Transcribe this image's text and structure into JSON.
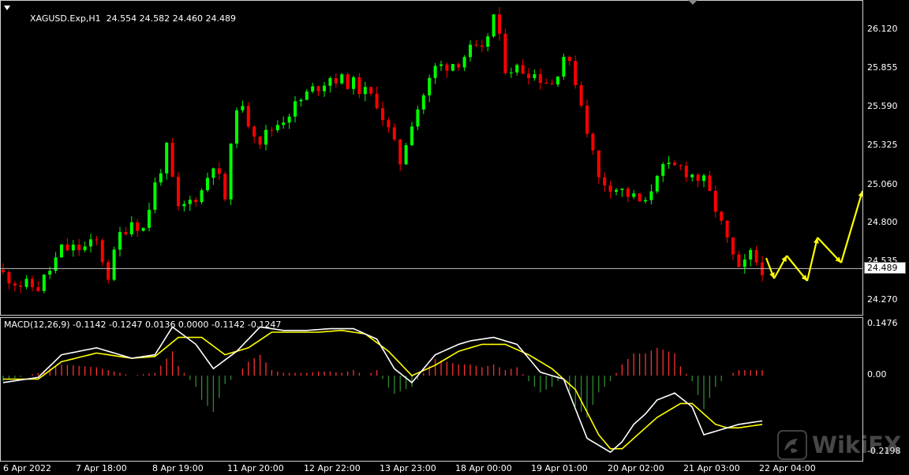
{
  "chart_header": {
    "symbol_menu_icon": "triangle-down-icon",
    "symbol_timeframe": "XAGUSD.Exp,H1",
    "ohlc": "24.554 24.582 24.460 24.489"
  },
  "macd_header": {
    "text": "MACD(12,26,9) -0.1142 -0.1247 0.0136 0.0000 -0.1142 -0.1247"
  },
  "price_axis": [
    "26.120",
    "25.855",
    "25.590",
    "25.325",
    "25.060",
    "24.800",
    "24.535",
    "24.270"
  ],
  "current_price": "24.489",
  "macd_axis": [
    "0.1476",
    "0.00",
    "-0.2198"
  ],
  "time_axis": [
    "6 Apr 2022",
    "7 Apr 18:00",
    "8 Apr 19:00",
    "11 Apr 20:00",
    "12 Apr 22:00",
    "13 Apr 23:00",
    "18 Apr 00:00",
    "19 Apr 01:00",
    "20 Apr 02:00",
    "21 Apr 03:00",
    "22 Apr 04:00"
  ],
  "watermark": {
    "text": "WikiFX",
    "icon": "wikifx-logo-icon"
  },
  "colors": {
    "background": "#000000",
    "bull_candle": "#00ff00",
    "bear_candle": "#ff0000",
    "macd_line": "#ffffff",
    "signal_line": "#ffff00",
    "histogram_positive": "#ff3030",
    "histogram_negative": "#2e8b2e",
    "annotation_arrows": "#ffff00",
    "price_line": "#c0c0c0"
  },
  "chart_data": [
    {
      "type": "candlestick",
      "title": "XAGUSD.Exp,H1",
      "ylim": [
        24.18,
        26.25
      ],
      "close_path": [
        [
          0,
          24.45
        ],
        [
          3,
          24.38
        ],
        [
          6,
          24.36
        ],
        [
          8,
          24.48
        ],
        [
          10,
          24.62
        ],
        [
          14,
          24.63
        ],
        [
          16,
          24.67
        ],
        [
          18,
          24.44
        ],
        [
          20,
          24.72
        ],
        [
          22,
          24.82
        ],
        [
          24,
          24.76
        ],
        [
          26,
          25.06
        ],
        [
          28,
          25.3
        ],
        [
          30,
          24.88
        ],
        [
          34,
          25.02
        ],
        [
          36,
          25.22
        ],
        [
          38,
          24.97
        ],
        [
          40,
          25.62
        ],
        [
          44,
          25.37
        ],
        [
          48,
          25.52
        ],
        [
          52,
          25.68
        ],
        [
          56,
          25.8
        ],
        [
          60,
          25.75
        ],
        [
          64,
          25.63
        ],
        [
          66,
          25.43
        ],
        [
          68,
          25.22
        ],
        [
          70,
          25.5
        ],
        [
          74,
          25.86
        ],
        [
          78,
          25.91
        ],
        [
          80,
          25.98
        ],
        [
          82,
          25.96
        ],
        [
          84,
          26.22
        ],
        [
          86,
          25.87
        ],
        [
          90,
          25.84
        ],
        [
          94,
          25.75
        ],
        [
          96,
          25.95
        ],
        [
          98,
          25.78
        ],
        [
          100,
          25.45
        ],
        [
          102,
          25.1
        ],
        [
          106,
          25.02
        ],
        [
          110,
          24.92
        ],
        [
          112,
          25.16
        ],
        [
          116,
          25.18
        ],
        [
          120,
          25.08
        ],
        [
          122,
          24.9
        ],
        [
          124,
          24.67
        ],
        [
          126,
          24.46
        ],
        [
          128,
          24.58
        ],
        [
          130,
          24.49
        ]
      ]
    },
    {
      "type": "line",
      "title": "MACD(12,26,9)",
      "ylim": [
        -0.2198,
        0.1476
      ],
      "series": [
        {
          "name": "MACD",
          "x": [
            0,
            6,
            10,
            16,
            22,
            26,
            29,
            33,
            36,
            40,
            44,
            48,
            52,
            56,
            60,
            64,
            67,
            70,
            74,
            78,
            80,
            84,
            88,
            92,
            96,
            100,
            104,
            106,
            108,
            110,
            112,
            115,
            118,
            120,
            122,
            124,
            126,
            128,
            130
          ],
          "values": [
            -0.02,
            -0.005,
            0.06,
            0.08,
            0.05,
            0.06,
            0.14,
            0.09,
            0.02,
            0.07,
            0.14,
            0.13,
            0.13,
            0.135,
            0.135,
            0.105,
            0.02,
            -0.02,
            0.06,
            0.09,
            0.1,
            0.11,
            0.09,
            0.01,
            -0.01,
            -0.18,
            -0.22,
            -0.19,
            -0.14,
            -0.11,
            -0.07,
            -0.05,
            -0.09,
            -0.17,
            -0.16,
            -0.15,
            -0.14,
            -0.135,
            -0.13
          ]
        },
        {
          "name": "Signal",
          "x": [
            0,
            6,
            10,
            16,
            22,
            26,
            30,
            34,
            38,
            42,
            46,
            50,
            54,
            58,
            62,
            66,
            70,
            74,
            78,
            82,
            86,
            90,
            94,
            98,
            102,
            104,
            106,
            108,
            110,
            112,
            114,
            116,
            118,
            120,
            122,
            124,
            126,
            128,
            130
          ],
          "values": [
            -0.01,
            -0.01,
            0.04,
            0.065,
            0.05,
            0.055,
            0.11,
            0.11,
            0.06,
            0.08,
            0.125,
            0.125,
            0.125,
            0.13,
            0.12,
            0.07,
            0.0,
            0.03,
            0.07,
            0.09,
            0.09,
            0.06,
            0.02,
            -0.04,
            -0.17,
            -0.21,
            -0.21,
            -0.18,
            -0.15,
            -0.12,
            -0.1,
            -0.08,
            -0.08,
            -0.11,
            -0.14,
            -0.15,
            -0.15,
            -0.145,
            -0.14
          ]
        }
      ]
    }
  ]
}
